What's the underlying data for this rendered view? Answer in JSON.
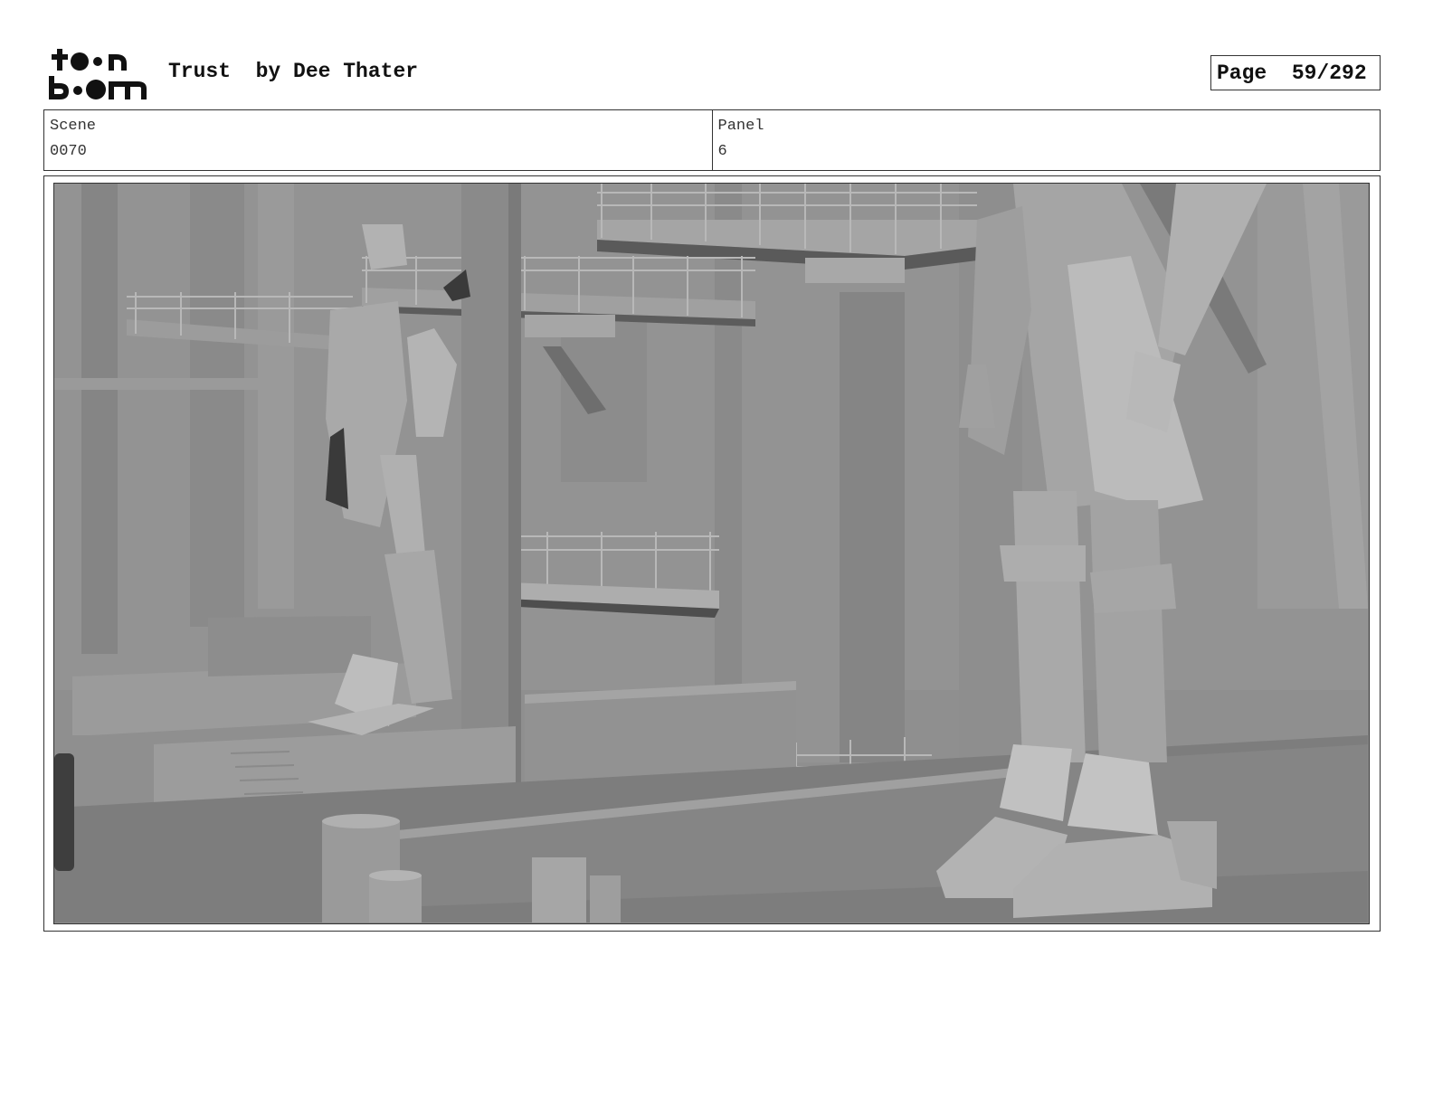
{
  "header": {
    "logo_top": "toon",
    "logo_bottom": "boom",
    "title": "Trust  by Dee Thater",
    "page_label": "Page  59/292"
  },
  "info": {
    "scene_label": "Scene",
    "scene_value": "0070",
    "panel_label": "Panel",
    "panel_value": "6"
  },
  "panel": {
    "image_icon": "3d-render-robots-hangar"
  }
}
